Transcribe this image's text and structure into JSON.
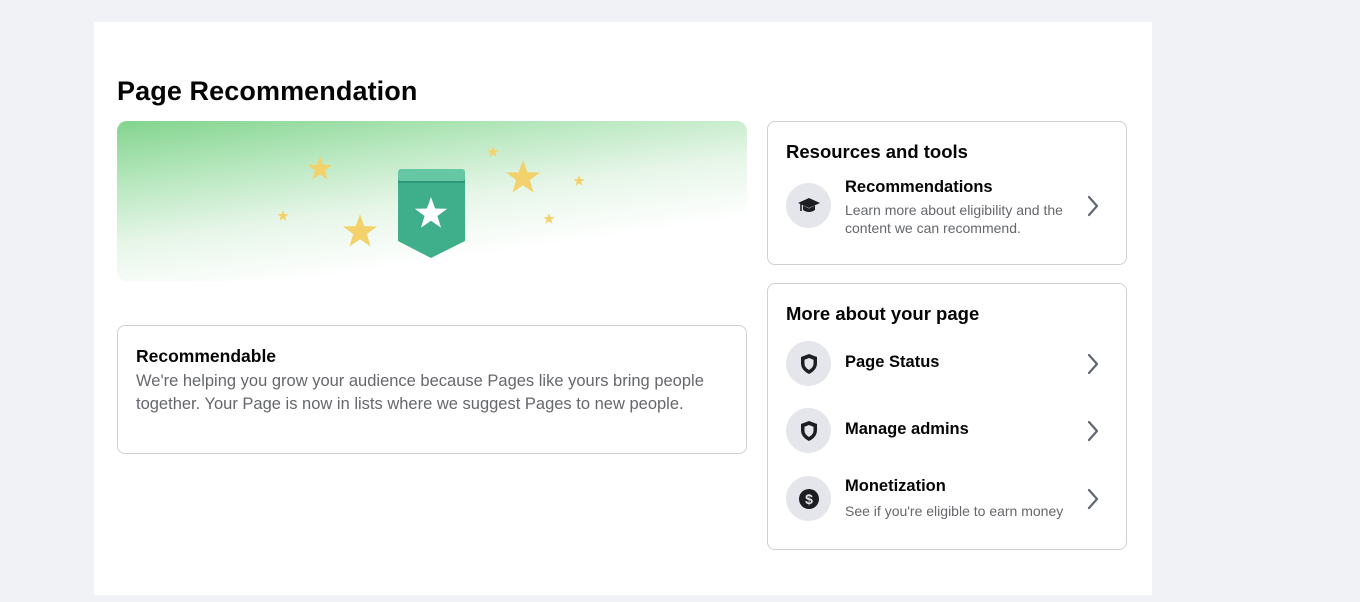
{
  "page": {
    "title": "Page Recommendation"
  },
  "status_card": {
    "title": "Recommendable",
    "description": "We're helping you grow your audience because Pages like yours bring people together. Your Page is now in lists where we suggest Pages to new people."
  },
  "resources": {
    "heading": "Resources and tools",
    "items": [
      {
        "label": "Recommendations",
        "description": "Learn more about eligibility and the content we can recommend.",
        "icon": "graduation-cap-icon"
      }
    ]
  },
  "more": {
    "heading": "More about your page",
    "items": [
      {
        "label": "Page Status",
        "icon": "shield-icon"
      },
      {
        "label": "Manage admins",
        "icon": "shield-icon"
      },
      {
        "label": "Monetization",
        "description": "See if you're eligible to earn money",
        "icon": "dollar-icon"
      }
    ]
  },
  "colors": {
    "background": "#f0f2f5",
    "panel": "#ffffff",
    "badge_teal": "#3fae8a",
    "star_yellow": "#f4d26b",
    "hero_green": "#82d48e",
    "secondary_text": "#65676b",
    "border": "#ced0d4"
  }
}
